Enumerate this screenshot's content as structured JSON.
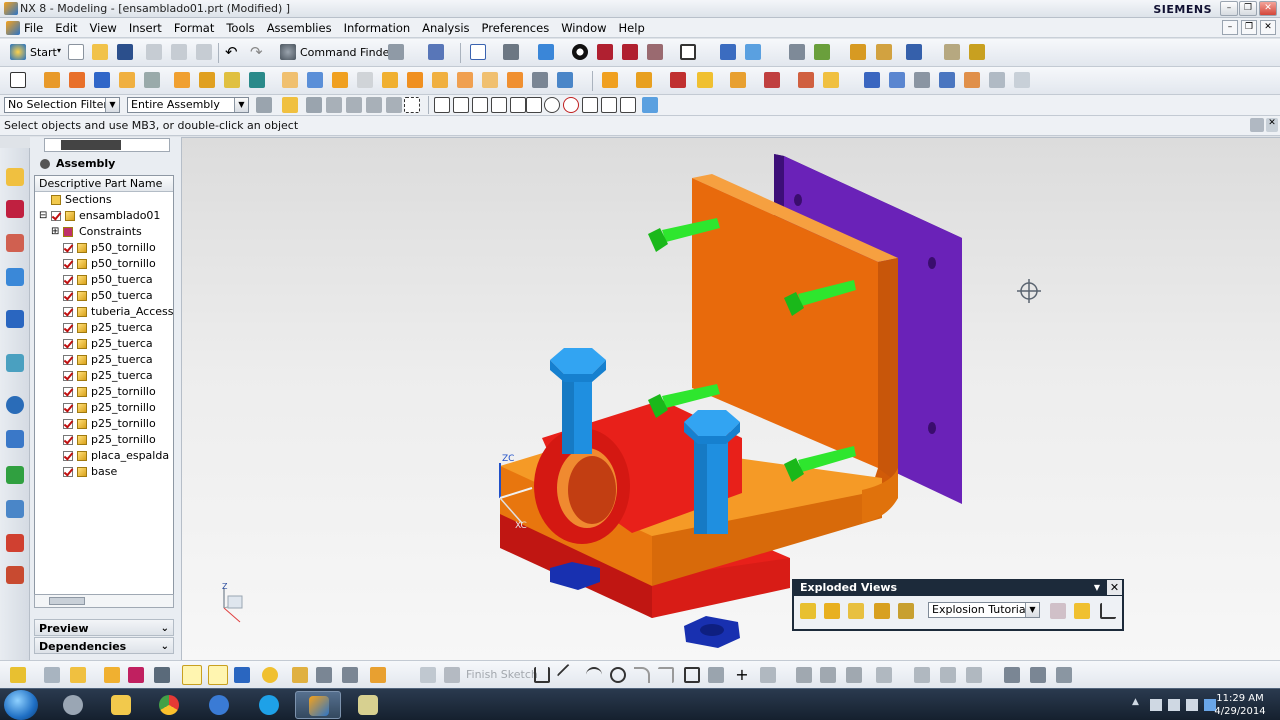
{
  "window": {
    "title": "NX 8 - Modeling - [ensamblado01.prt (Modified) ]",
    "brand": "SIEMENS",
    "controls": {
      "minimize": "–",
      "restore": "❐",
      "close": "✕"
    }
  },
  "menu": {
    "items": [
      "File",
      "Edit",
      "View",
      "Insert",
      "Format",
      "Tools",
      "Assemblies",
      "Information",
      "Analysis",
      "Preferences",
      "Window",
      "Help"
    ]
  },
  "toolbar": {
    "start_label": "Start",
    "command_finder_label": "Command Finder"
  },
  "selection_bar": {
    "filter_value": "No Selection Filter",
    "scope_value": "Entire Assembly"
  },
  "cue_line": "Select objects and use MB3, or double-click an object",
  "navigator": {
    "title": "Assembly Navigator",
    "column_header": "Descriptive Part Name",
    "nodes": [
      {
        "label": "Sections",
        "type": "folder",
        "level": 1
      },
      {
        "label": "ensamblado01",
        "type": "assembly",
        "level": 1
      },
      {
        "label": "Constraints",
        "type": "constraints",
        "level": 2
      },
      {
        "label": "p50_tornillo",
        "type": "part",
        "level": 2
      },
      {
        "label": "p50_tornillo",
        "type": "part",
        "level": 2
      },
      {
        "label": "p50_tuerca",
        "type": "part",
        "level": 2
      },
      {
        "label": "p50_tuerca",
        "type": "part",
        "level": 2
      },
      {
        "label": "tuberia_Access",
        "type": "part",
        "level": 2
      },
      {
        "label": "p25_tuerca",
        "type": "part",
        "level": 2
      },
      {
        "label": "p25_tuerca",
        "type": "part",
        "level": 2
      },
      {
        "label": "p25_tuerca",
        "type": "part",
        "level": 2
      },
      {
        "label": "p25_tuerca",
        "type": "part",
        "level": 2
      },
      {
        "label": "p25_tornillo",
        "type": "part",
        "level": 2
      },
      {
        "label": "p25_tornillo",
        "type": "part",
        "level": 2
      },
      {
        "label": "p25_tornillo",
        "type": "part",
        "level": 2
      },
      {
        "label": "p25_tornillo",
        "type": "part",
        "level": 2
      },
      {
        "label": "placa_espalda",
        "type": "part",
        "level": 2
      },
      {
        "label": "base",
        "type": "part",
        "level": 2
      }
    ],
    "panels": [
      "Preview",
      "Dependencies"
    ]
  },
  "viewport": {
    "triad_label_zc": "ZC",
    "triad_label_xc": "XC",
    "mini_triad_z": "Z",
    "colors": {
      "bracket": "#f07c10",
      "plate": "#6a22b8",
      "base": "#e8201a",
      "bolt_big": "#1f8fe0",
      "bolt_small": "#22dd22",
      "nut": "#1830b0"
    }
  },
  "exploded_views": {
    "title": "Exploded Views",
    "selected": "Explosion Tutorial"
  },
  "bottom_toolbar": {
    "finish_sketch_label": "Finish Sketch"
  },
  "taskbar": {
    "time": "11:29 AM",
    "date": "4/29/2014"
  }
}
